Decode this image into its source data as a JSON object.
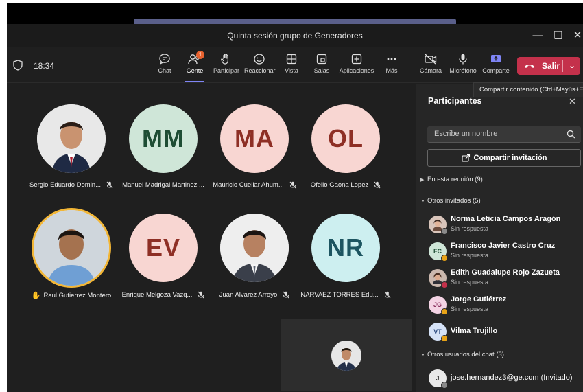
{
  "window": {
    "title": "Quinta sesión grupo de Generadores"
  },
  "toolbar": {
    "time": "18:34",
    "buttons": [
      {
        "label": "Chat",
        "icon": "chat-icon"
      },
      {
        "label": "Gente",
        "icon": "people-icon",
        "badge": "1"
      },
      {
        "label": "Participar",
        "icon": "raise-hand-icon"
      },
      {
        "label": "Reaccionar",
        "icon": "smiley-icon"
      },
      {
        "label": "Vista",
        "icon": "grid-icon"
      },
      {
        "label": "Salas",
        "icon": "breakout-rooms-icon"
      },
      {
        "label": "Aplicaciones",
        "icon": "add-apps-icon"
      },
      {
        "label": "Más",
        "icon": "more-icon"
      },
      {
        "label": "Cámara",
        "icon": "camera-off-icon"
      },
      {
        "label": "Micrófono",
        "icon": "microphone-icon"
      },
      {
        "label": "Comparte",
        "icon": "share-screen-icon"
      }
    ],
    "leave_label": "Salir",
    "tooltip": "Compartir contenido (Ctrl+Mayús+E)"
  },
  "stage": {
    "participants": [
      {
        "name": "Sergio Eduardo Domin...",
        "type": "photo",
        "muted": true
      },
      {
        "name": "Manuel Madrigal Martinez ...",
        "initials": "MM",
        "color": "#cfe6d8"
      },
      {
        "name": "Mauricio Cuellar Ahum...",
        "initials": "MA",
        "color": "#f8d6d2",
        "muted": true
      },
      {
        "name": "Ofelio Gaona Lopez",
        "initials": "OL",
        "color": "#f8d6d2",
        "muted": true
      },
      {
        "name": "Raul Gutierrez Montero",
        "type": "photo",
        "hand_raised": true
      },
      {
        "name": "Enrique Melgoza Vazq...",
        "initials": "EV",
        "color": "#f8d6d2",
        "muted": true
      },
      {
        "name": "Juan Alvarez Arroyo",
        "type": "photo",
        "muted": true
      },
      {
        "name": "NARVAEZ TORRES Edu...",
        "initials": "NR",
        "color": "#cdeff0",
        "muted": true
      }
    ]
  },
  "panel": {
    "title": "Participantes",
    "search_placeholder": "Escribe un nombre",
    "share_invite": "Compartir invitación",
    "section_meeting": "En esta reunión (9)",
    "section_invited": "Otros invitados (5)",
    "invited": [
      {
        "name": "Norma Leticia Campos Aragón",
        "status": "Sin respuesta",
        "avatar": "photo"
      },
      {
        "name": "Francisco Javier Castro Cruz",
        "status": "Sin respuesta",
        "initials": "FC"
      },
      {
        "name": "Edith Guadalupe Rojo Zazueta",
        "status": "Sin respuesta",
        "avatar": "photo"
      },
      {
        "name": "Jorge Gutiérrez",
        "status": "Sin respuesta",
        "initials": "JG"
      },
      {
        "name": "Vilma Trujillo",
        "initials": "VT"
      }
    ],
    "section_chat": "Otros usuarios del chat (3)",
    "chat_users": [
      {
        "name": "jose.hernandez3@ge.com (Invitado)",
        "initials": "J"
      }
    ]
  }
}
